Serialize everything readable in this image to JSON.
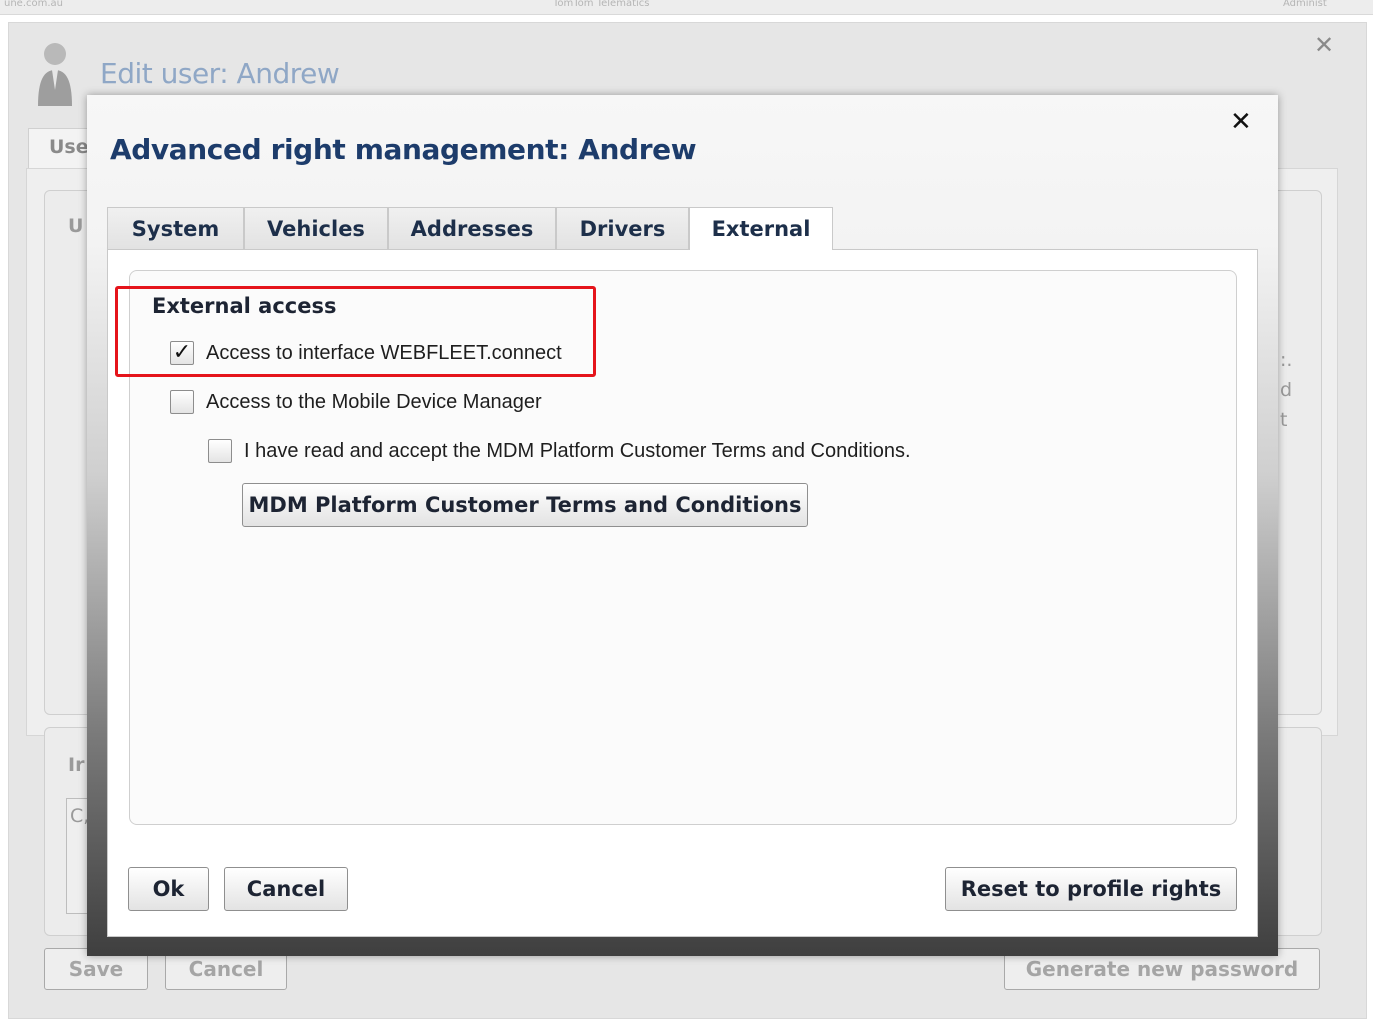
{
  "background": {
    "topbar": {
      "left_text": "une.com.au",
      "center_text": "TomTom Telematics",
      "right_text": "Administ"
    },
    "edit_title": "Edit user: Andrew",
    "tab_fragment": "Use",
    "section_fragments": [
      "U",
      "Ir",
      "C,"
    ],
    "side_fragments": [
      ":.",
      "d",
      "t"
    ],
    "buttons": {
      "save": "Save",
      "cancel": "Cancel",
      "generate": "Generate new password"
    }
  },
  "modal": {
    "title": "Advanced right management: Andrew",
    "tabs": [
      {
        "label": "System"
      },
      {
        "label": "Vehicles"
      },
      {
        "label": "Addresses"
      },
      {
        "label": "Drivers"
      },
      {
        "label": "External",
        "active": true
      }
    ],
    "section_title": "External access",
    "options": [
      {
        "label": "Access to interface WEBFLEET.connect",
        "checked": true,
        "mark": "✓"
      },
      {
        "label": "Access to the Mobile Device Manager",
        "checked": false,
        "mark": ""
      },
      {
        "label": "I have read and accept the MDM Platform Customer Terms and Conditions.",
        "checked": false,
        "mark": ""
      }
    ],
    "terms_button": "MDM Platform Customer Terms and Conditions",
    "footer": {
      "ok": "Ok",
      "cancel": "Cancel",
      "reset": "Reset to profile rights"
    }
  },
  "colors": {
    "title": "#1d3c6b",
    "highlight": "#e5141b"
  }
}
